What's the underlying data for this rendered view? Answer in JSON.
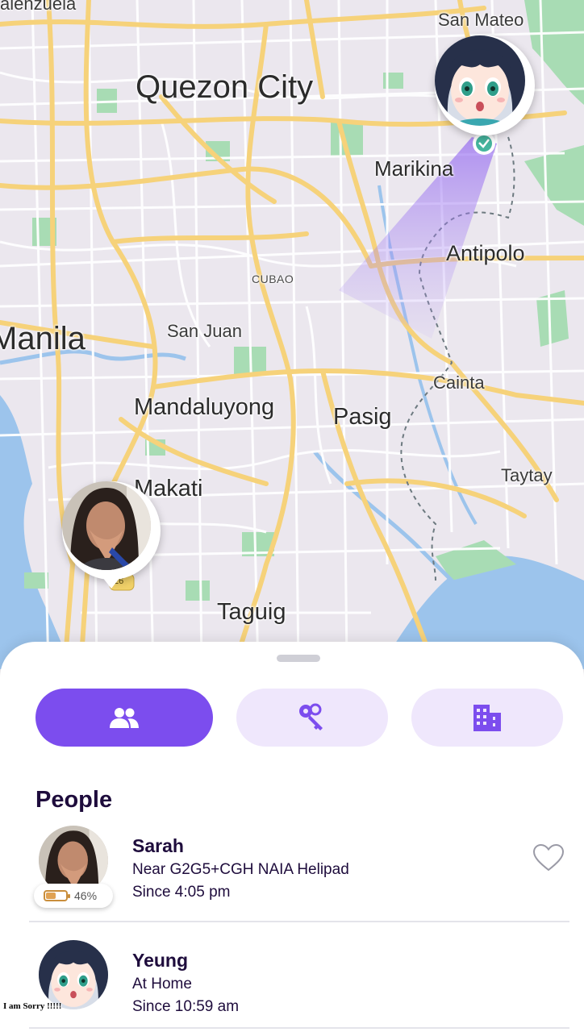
{
  "map": {
    "labels": {
      "valenzuela": "alenzuela",
      "san_mateo": "San Mateo",
      "quezon_city": "Quezon City",
      "marikina": "Marikina",
      "antipolo": "Antipolo",
      "cubao": "CUBAO",
      "manila": "Manila",
      "san_juan": "San Juan",
      "cainta": "Cainta",
      "mandaluyong": "Mandaluyong",
      "pasig": "Pasig",
      "taytay": "Taytay",
      "makati": "Makati",
      "taguig": "Taguig",
      "route_shield": "26"
    },
    "colors": {
      "land": "#ebe7ee",
      "water": "#9cc4ec",
      "park": "#a8dcb4",
      "major_road": "#f6d27a",
      "minor_road": "#ffffff",
      "path": "#7c4dee"
    }
  },
  "tabs": [
    {
      "id": "people",
      "icon": "people-icon",
      "active": true
    },
    {
      "id": "keys",
      "icon": "keys-icon",
      "active": false
    },
    {
      "id": "places",
      "icon": "building-icon",
      "active": false
    }
  ],
  "section_title": "People",
  "people": [
    {
      "name": "Sarah",
      "location": "Near G2G5+CGH NAIA Helipad",
      "since": "Since 4:05 pm",
      "battery_text": "46%",
      "battery_level": 0.46,
      "favorite_icon": "heart-outline-icon"
    },
    {
      "name": "Yeung",
      "location": "At Home",
      "since": "Since 10:59 am"
    }
  ],
  "caption": "I am Sorry !!!!!",
  "accent": "#7c4dee",
  "text_dark": "#1e0c3c"
}
